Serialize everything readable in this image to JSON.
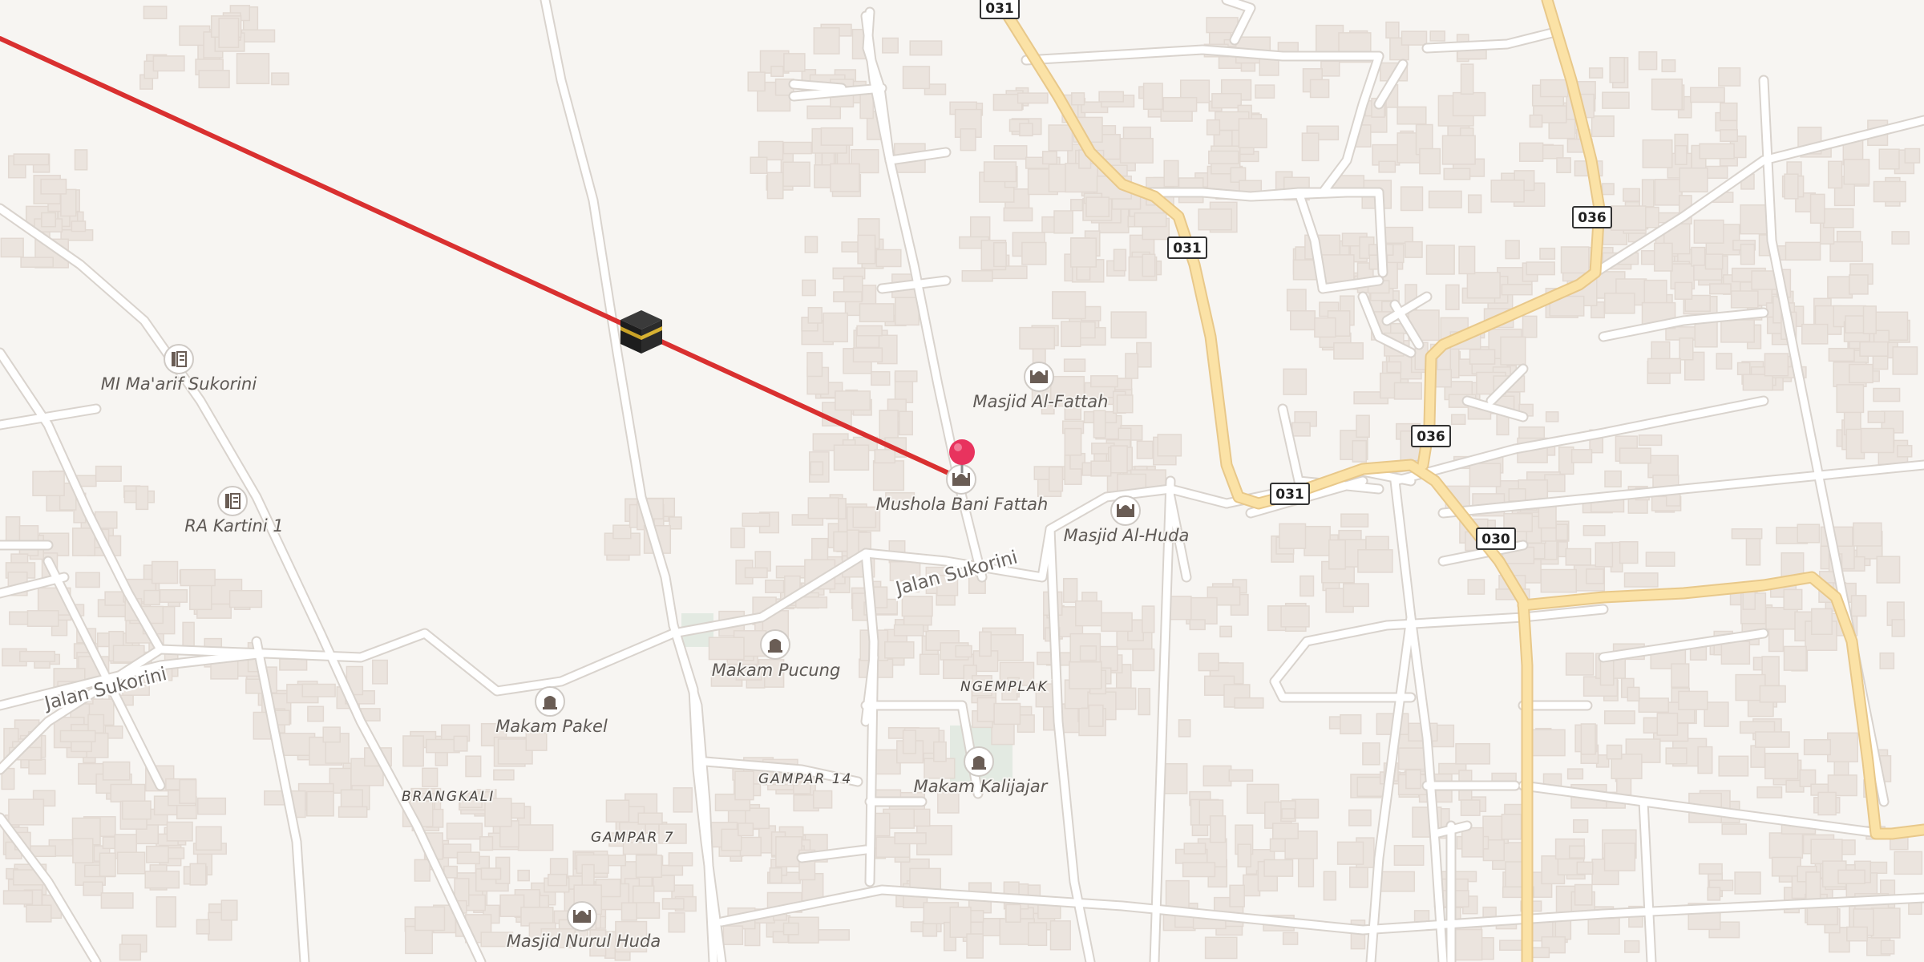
{
  "map": {
    "route_color": "#d93030",
    "pin_color": "#e8335e",
    "major_road_color": "#fbe2a6",
    "background_color": "#f7f5f2"
  },
  "route_shields": [
    "031",
    "031",
    "036",
    "036",
    "031",
    "030"
  ],
  "pois": [
    {
      "key": "mi_maarif",
      "label": "MI Ma'arif Sukorini",
      "icon": "school-icon"
    },
    {
      "key": "ra_kartini",
      "label": "RA Kartini 1",
      "icon": "school-icon"
    },
    {
      "key": "masjid_alfattah",
      "label": "Masjid Al-Fattah",
      "icon": "mosque-icon"
    },
    {
      "key": "mushola",
      "label": "Mushola Bani Fattah",
      "icon": "mosque-icon"
    },
    {
      "key": "masjid_alhuda",
      "label": "Masjid Al-Huda",
      "icon": "mosque-icon"
    },
    {
      "key": "makam_pucung",
      "label": "Makam Pucung",
      "icon": "cemetery-icon"
    },
    {
      "key": "makam_pakel",
      "label": "Makam Pakel",
      "icon": "cemetery-icon"
    },
    {
      "key": "makam_kalijajar",
      "label": "Makam Kalijajar",
      "icon": "cemetery-icon"
    },
    {
      "key": "masjid_nurul_huda",
      "label": "Masjid Nurul Huda",
      "icon": "mosque-icon"
    }
  ],
  "streets": [
    "Jalan Sukorini",
    "Jalan Sukorini"
  ],
  "areas": [
    "NGEMPLAK",
    "BRANGKALI",
    "GAMPAR 14",
    "GAMPAR 7"
  ],
  "markers": {
    "kaaba": "kaaba-icon",
    "pin": "location-pin-icon"
  }
}
